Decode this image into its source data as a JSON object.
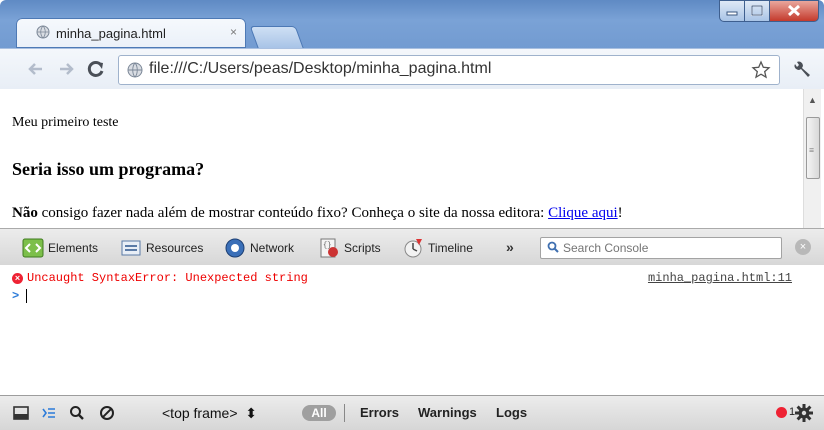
{
  "browser": {
    "tab": {
      "title": "minha_pagina.html",
      "close": "×"
    },
    "address": {
      "url": "file:///C:/Users/peas/Desktop/minha_pagina.html"
    }
  },
  "page": {
    "line1": "Meu primeiro teste",
    "heading": "Seria isso um programa?",
    "p2_bold": "Não",
    "p2_text": " consigo fazer nada além de mostrar conteúdo fixo? Conheça o site da nossa editora: ",
    "p2_link": "Clique aqui",
    "p2_end": "!"
  },
  "devtools": {
    "tabs": [
      {
        "label": "Elements",
        "icon": "elements-icon"
      },
      {
        "label": "Resources",
        "icon": "resources-icon"
      },
      {
        "label": "Network",
        "icon": "network-icon"
      },
      {
        "label": "Scripts",
        "icon": "scripts-icon"
      },
      {
        "label": "Timeline",
        "icon": "timeline-icon"
      }
    ],
    "more": "»",
    "search_placeholder": "Search Console",
    "console": {
      "error": "Uncaught SyntaxError: Unexpected string",
      "source": "minha_pagina.html:11",
      "prompt": ">"
    },
    "statusbar": {
      "frame": "<top frame>",
      "frame_arrows": "⬍",
      "all": "All",
      "errors": "Errors",
      "warnings": "Warnings",
      "logs": "Logs",
      "error_count": "1"
    }
  },
  "colors": {
    "accent": "#2b7bd9",
    "error": "#ee2233",
    "link": "#0000ee"
  }
}
